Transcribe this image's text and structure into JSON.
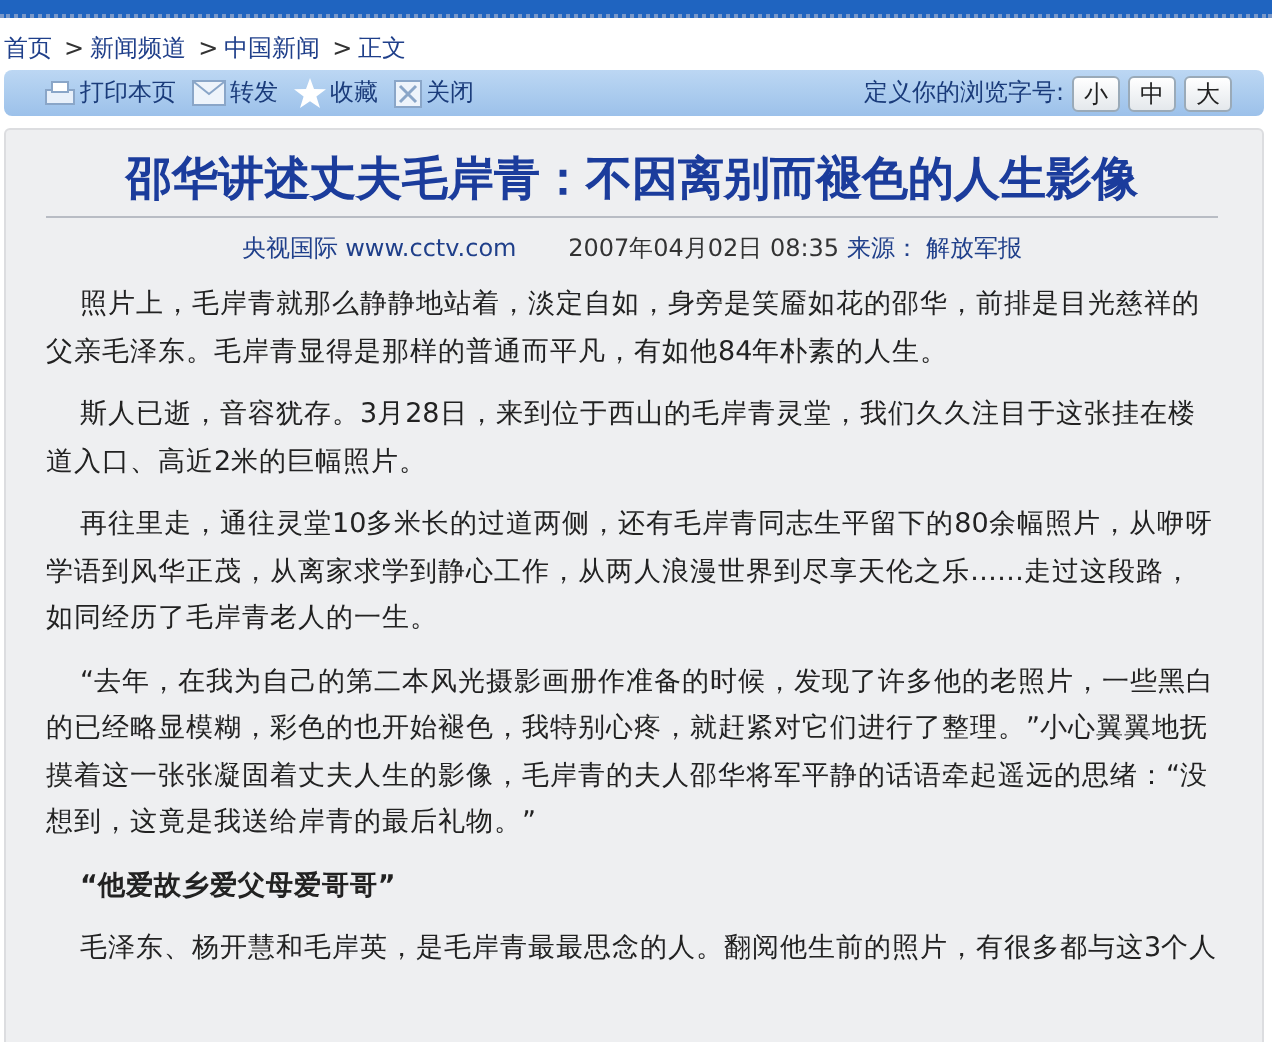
{
  "breadcrumb": [
    {
      "label": "首页"
    },
    {
      "label": "新闻频道",
      "separator": ">"
    },
    {
      "label": "中国新闻",
      "separator": ">"
    },
    {
      "label": "正文",
      "separator": ">"
    }
  ],
  "toolbar": {
    "actions": [
      {
        "kind": "print",
        "label": "打印本页"
      },
      {
        "kind": "mail",
        "label": "转发"
      },
      {
        "kind": "star",
        "label": "收藏"
      },
      {
        "kind": "close",
        "label": "关闭"
      }
    ],
    "font_size_label": "定义你的浏览字号:",
    "font_sizes": [
      "小",
      "中",
      "大"
    ]
  },
  "article": {
    "title": "邵华讲述丈夫毛岸青：不因离别而褪色的人生影像",
    "meta": {
      "site": "央视国际 www.cctv.com",
      "date": "2007年04月02日 08:35",
      "source_label": "来源：",
      "source": "解放军报"
    },
    "blocks": [
      {
        "kind": "paragraph",
        "text": "照片上，毛岸青就那么静静地站着，淡定自如，身旁是笑靥如花的邵华，前排是目光慈祥的父亲毛泽东。毛岸青显得是那样的普通而平凡，有如他84年朴素的人生。"
      },
      {
        "kind": "paragraph",
        "text": "斯人已逝，音容犹存。3月28日，来到位于西山的毛岸青灵堂，我们久久注目于这张挂在楼道入口、高近2米的巨幅照片。"
      },
      {
        "kind": "paragraph",
        "text": "再往里走，通往灵堂10多米长的过道两侧，还有毛岸青同志生平留下的80余幅照片，从咿呀学语到风华正茂，从离家求学到静心工作，从两人浪漫世界到尽享天伦之乐……走过这段路，如同经历了毛岸青老人的一生。"
      },
      {
        "kind": "paragraph",
        "text": "“去年，在我为自己的第二本风光摄影画册作准备的时候，发现了许多他的老照片，一些黑白的已经略显模糊，彩色的也开始褪色，我特别心疼，就赶紧对它们进行了整理。”小心翼翼地抚摸着这一张张凝固着丈夫人生的影像，毛岸青的夫人邵华将军平静的话语牵起遥远的思绪：“没想到，这竟是我送给岸青的最后礼物。”"
      },
      {
        "kind": "heading",
        "text": "“他爱故乡爱父母爱哥哥”"
      },
      {
        "kind": "paragraph",
        "text": "毛泽东、杨开慧和毛岸英，是毛岸青最最思念的人。翻阅他生前的照片，有很多都与这3个人"
      }
    ]
  }
}
